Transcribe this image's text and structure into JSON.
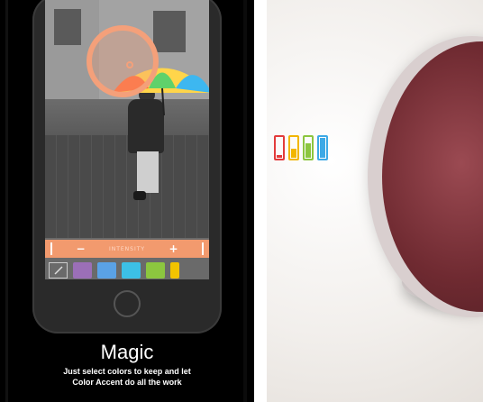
{
  "left": {
    "caption": {
      "title": "Magic",
      "line1": "Just select colors to keep and let",
      "line2": "Color Accent do all the work"
    },
    "slider": {
      "minus": "−",
      "label": "INTENSITY",
      "plus": "+"
    },
    "palette": {
      "swatches": [
        "#9b6fb7",
        "#5aa2e6",
        "#3cc0e6",
        "#8cc63f",
        "#f2c300"
      ]
    }
  },
  "colors": {
    "accent_orange": "#f29a6e",
    "speaker_maroon": "#6f2a31"
  },
  "icons": {
    "picker": "eyedropper-icon",
    "batteries": [
      "battery-red-icon",
      "battery-yellow-icon",
      "battery-green-icon",
      "battery-blue-icon"
    ]
  }
}
